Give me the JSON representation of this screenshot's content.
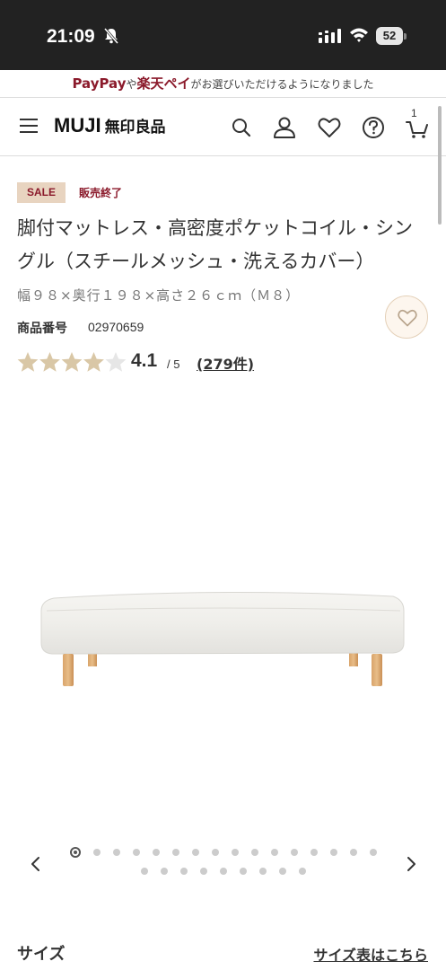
{
  "status_bar": {
    "time": "21:09",
    "battery": "52"
  },
  "promo": {
    "paypay": "PayPay",
    "ya": "や",
    "rakuten": "楽天ペイ",
    "rest": "がお選びいただけるようになりました"
  },
  "header": {
    "logo_text": "MUJI",
    "logo_kanji": "無印良品",
    "cart_count": "1"
  },
  "product": {
    "sale_badge": "SALE",
    "status": "販売終了",
    "title": "脚付マットレス・高密度ポケットコイル・シングル（スチールメッシュ・洗えるカバー）",
    "size": "幅９８×奥行１９８×高さ２６ｃｍ（Ｍ８）",
    "code_label": "商品番号",
    "code_value": "02970659",
    "rating": 4.1,
    "rating_text": "4.1",
    "rating_max": "/ 5",
    "review_count": "(279件)"
  },
  "carousel": {
    "row1_dots": 16,
    "row2_dots": 9,
    "active_index": 0
  },
  "size_section": {
    "heading": "サイズ",
    "link": "サイズ表はこちら"
  },
  "colors": {
    "brand_red": "#8b1a2b",
    "sale_bg": "#e8d4c0",
    "star_fill": "#d9c7a6",
    "star_empty": "#e6e6e6"
  }
}
